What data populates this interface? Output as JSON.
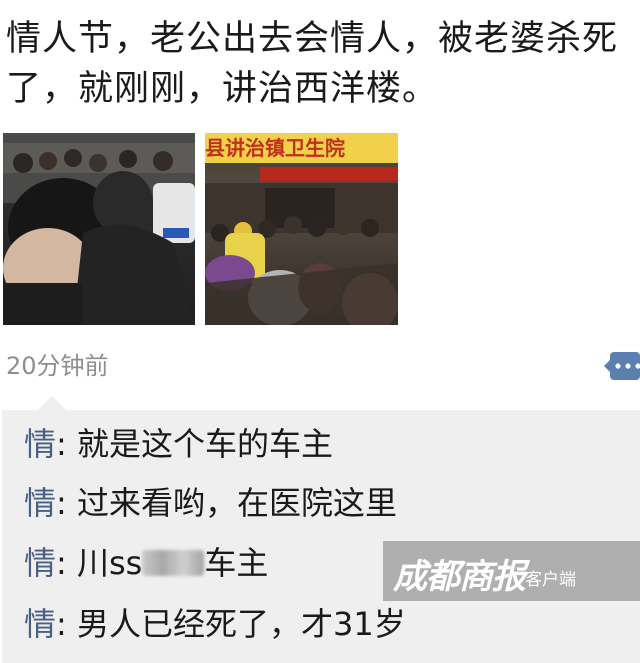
{
  "post": {
    "text": "情人节，老公出去会情人，被老婆杀死了，就刚刚，讲治西洋楼。",
    "timestamp": "20分钟前"
  },
  "photos": {
    "right_sign_text": "县讲治镇卫生院"
  },
  "comments": [
    {
      "author": "情",
      "separator": ": ",
      "text": "就是这个车的车主"
    },
    {
      "author": "情",
      "separator": ": ",
      "text": "过来看哟，在医院这里"
    },
    {
      "author": "情",
      "separator": ": ",
      "text_before": "川ss",
      "text_after": "车主"
    },
    {
      "author": "情",
      "separator": ": ",
      "text": "男人已经死了，才31岁"
    }
  ],
  "watermark": {
    "logo": "成都商报",
    "sub": "客户端"
  },
  "colors": {
    "author": "#4a5f86",
    "comment_bg": "#efefef",
    "timestamp": "#8e8e8e",
    "comment_icon": "#5b7fae"
  }
}
